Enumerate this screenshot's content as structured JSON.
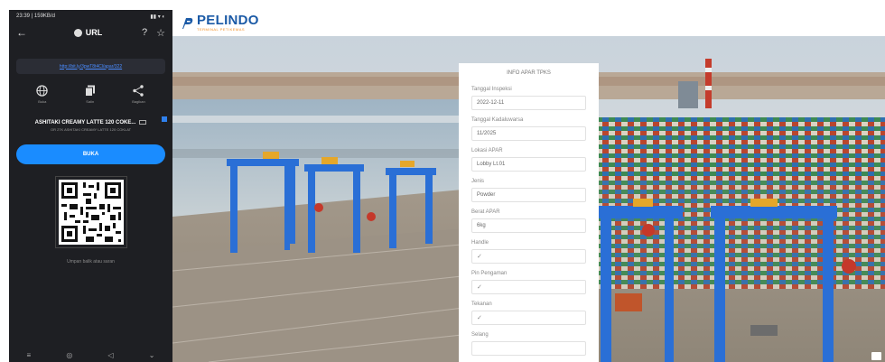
{
  "phone": {
    "status_left": "23:39 | 159KB/d",
    "page_title": "URL",
    "link_text": "http://bit.ly/3pwT8t4Cl/apar/322",
    "actions": [
      {
        "icon": "globe-icon",
        "label": "Buka"
      },
      {
        "icon": "copy-icon",
        "label": "Salin"
      },
      {
        "icon": "share-icon",
        "label": "Bagikan"
      }
    ],
    "product_name": "ASHITAKI CREAMY LATTE 120 COKE...",
    "product_sub": "OR 27K ASHITAKI CREAMY LATTE 120 COKLAT",
    "open_button": "BUKA",
    "qr_hint": "Umpan balik atau saran"
  },
  "header": {
    "brand": "PELINDO",
    "tagline": "TERMINAL PETIKEMAS",
    "brand_color": "#1b5aa6",
    "tagline_color": "#f28a1c"
  },
  "form": {
    "title": "INFO APAR TPKS",
    "fields": [
      {
        "label": "Tanggal Inspeksi",
        "value": "2022-12-11"
      },
      {
        "label": "Tanggal Kadaluwarsa",
        "value": "11/2025"
      },
      {
        "label": "Lokasi APAR",
        "value": "Lobby Lt.01"
      },
      {
        "label": "Jenis",
        "value": "Powder"
      },
      {
        "label": "Berat APAR",
        "value": "6kg"
      },
      {
        "label": "Handle",
        "value": "✓"
      },
      {
        "label": "Pin Pengaman",
        "value": "✓"
      },
      {
        "label": "Tekanan",
        "value": "✓"
      },
      {
        "label": "Selang",
        "value": ""
      }
    ]
  },
  "colors": {
    "phone_bg": "#1e1f23",
    "accent_blue": "#1a8cff",
    "crane_blue": "#2a6fd6"
  }
}
